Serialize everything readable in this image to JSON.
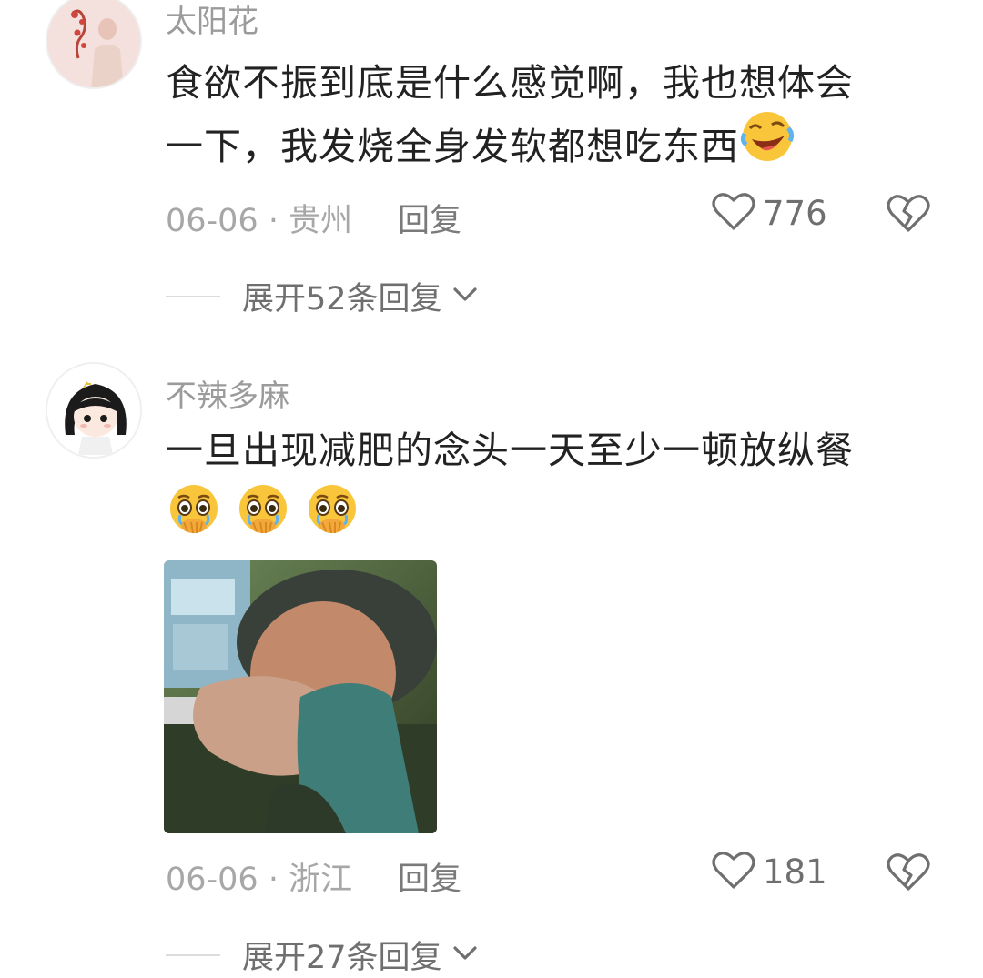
{
  "comments": [
    {
      "username": "太阳花",
      "text_line1": "食欲不振到底是什么感觉啊，我也想体会",
      "text_line2": "一下，我发烧全身发软都想吃东西",
      "emoji": "laughing-crying-emoji",
      "date_location": "06-06 · 贵州",
      "reply_label": "回复",
      "like_count": "776",
      "expand_label": "展开52条回复"
    },
    {
      "username": "不辣多麻",
      "text_line1": "一旦出现减肥的念头一天至少一顿放纵餐",
      "emoji": "pleading-face-emoji",
      "emoji_count": 3,
      "has_image": true,
      "date_location": "06-06 · 浙江",
      "reply_label": "回复",
      "like_count": "181",
      "expand_label": "展开27条回复"
    }
  ],
  "colors": {
    "text": "#222222",
    "muted": "#9b9b9b",
    "meta": "#a7a7a7",
    "icon": "#6f6f6f",
    "divider": "#dcdcdc",
    "emoji_yellow": "#f9c53b"
  }
}
